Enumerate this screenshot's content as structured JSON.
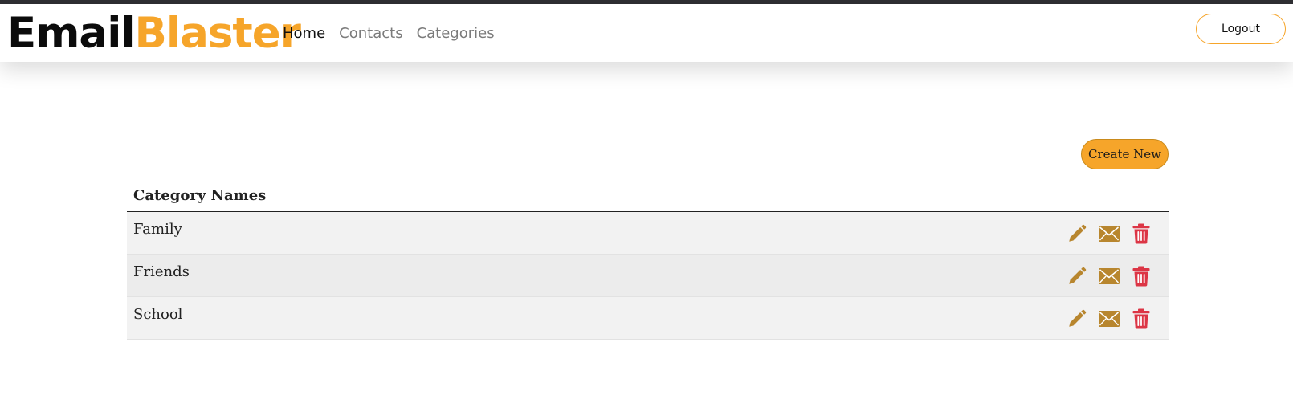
{
  "brand": {
    "part1": "Email",
    "part2": "Blaster"
  },
  "nav": {
    "links": [
      {
        "label": "Home",
        "active": true
      },
      {
        "label": "Contacts",
        "active": false
      },
      {
        "label": "Categories",
        "active": false
      }
    ],
    "logout_label": "Logout"
  },
  "main": {
    "create_label": "Create New",
    "table": {
      "header": "Category Names",
      "rows": [
        {
          "name": "Family"
        },
        {
          "name": "Friends"
        },
        {
          "name": "School"
        }
      ]
    }
  },
  "icons": {
    "edit": "pencil-icon",
    "email": "envelope-icon",
    "delete": "trash-icon"
  },
  "colors": {
    "accent": "#f6a52a",
    "icon_gold": "#b8862e",
    "icon_red": "#dc3545",
    "top_strip": "#2f2f33"
  }
}
